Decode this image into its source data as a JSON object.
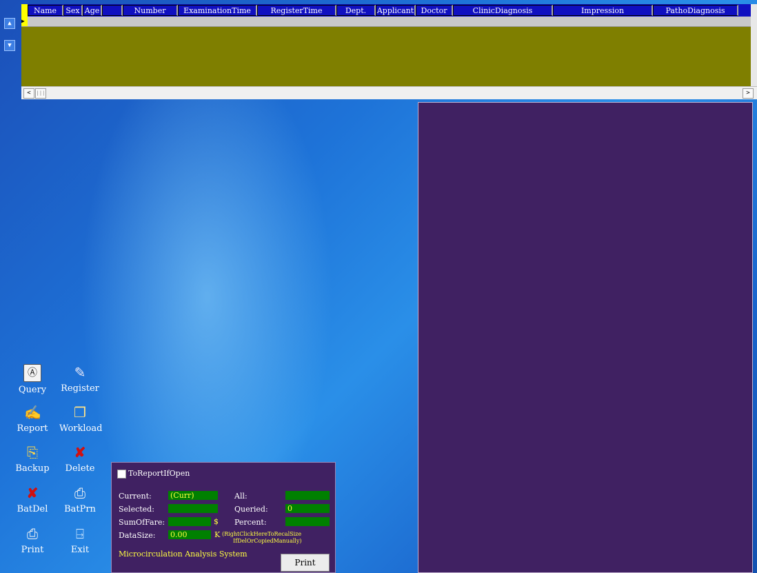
{
  "nav": {
    "up_icon": "triangle-up-icon",
    "down_icon": "triangle-down-icon",
    "up_glyph": "▲",
    "down_glyph": "▼"
  },
  "grid": {
    "columns": [
      "Name",
      "Sex",
      "Age",
      "Number",
      "ExaminationTime",
      "RegisterTime",
      "Dept.",
      "Applicant",
      "Doctor",
      "ClinicDiagnosis",
      "Impression",
      "PathoDiagnosis"
    ],
    "row_indicator": "▶",
    "hscroll_left": "<",
    "hscroll_right": ">",
    "hscroll_thumb": "|||",
    "colors": {
      "body": "#7f7f00",
      "header": "#1010c0",
      "indicator": "#ffff00"
    }
  },
  "tools": [
    {
      "label": "Query",
      "icon": "query-icon",
      "glyph": "Ⓐ"
    },
    {
      "label": "Register",
      "icon": "register-icon",
      "glyph": "✎"
    },
    {
      "label": "Report",
      "icon": "report-icon",
      "glyph": "✍"
    },
    {
      "label": "Workload",
      "icon": "workload-icon",
      "glyph": "❐"
    },
    {
      "label": "Backup",
      "icon": "backup-folder-icon",
      "glyph": "⎘"
    },
    {
      "label": "Delete",
      "icon": "delete-x-icon",
      "glyph": "✘"
    },
    {
      "label": "BatDel",
      "icon": "batch-delete-x-icon",
      "glyph": "✘"
    },
    {
      "label": "BatPrn",
      "icon": "batch-print-icon",
      "glyph": "⎙"
    },
    {
      "label": "Print",
      "icon": "printer-icon",
      "glyph": "⎙"
    },
    {
      "label": "Exit",
      "icon": "exit-door-icon",
      "glyph": "⍈"
    }
  ],
  "stats": {
    "checkbox_label": "ToReportIfOpen",
    "current_label": "Current:",
    "current_value": "(Curr)",
    "all_label": "All:",
    "all_value": "",
    "selected_label": "Selected:",
    "selected_value": "",
    "queried_label": "Queried:",
    "queried_value": "0",
    "sumoffare_label": "SumOfFare:",
    "sumoffare_value": "",
    "currency": "$",
    "percent_label": "Percent:",
    "percent_value": "",
    "datasize_label": "DataSize:",
    "datasize_value": "0.00",
    "datasize_unit": "K",
    "recalc_note_1": "(RightClickHereToRecalSize",
    "recalc_note_2": "IfDelOrCopiedManually)",
    "system_name": "Microcirculation Analysis System",
    "print_button": "Print"
  },
  "colors": {
    "panel_purple": "#402162",
    "value_green": "#008000",
    "value_text": "#ffff40"
  }
}
